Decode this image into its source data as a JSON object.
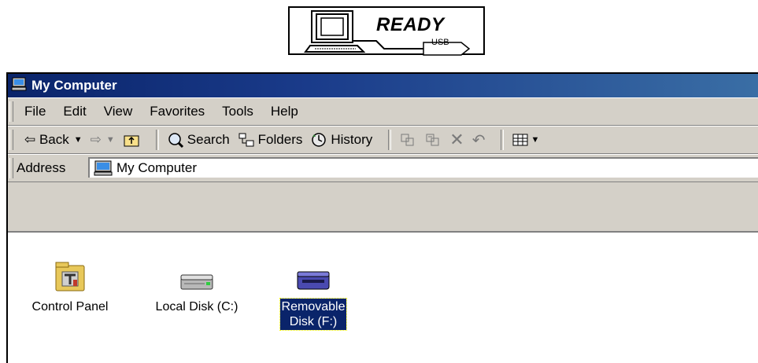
{
  "banner": {
    "status": "READY",
    "connector": "USB"
  },
  "window": {
    "title": "My Computer"
  },
  "menu": [
    "File",
    "Edit",
    "View",
    "Favorites",
    "Tools",
    "Help"
  ],
  "toolbar": {
    "back": "⇦ Back",
    "search": "Search",
    "folders": "Folders",
    "history": "History"
  },
  "address": {
    "label": "Address",
    "value": "My Computer"
  },
  "items": [
    {
      "label": "Control Panel",
      "icon": "control-panel-icon"
    },
    {
      "label": "Local Disk (C:)",
      "icon": "hard-disk-icon"
    },
    {
      "label": "Removable\nDisk (F:)",
      "icon": "removable-disk-icon",
      "selected": true
    }
  ]
}
